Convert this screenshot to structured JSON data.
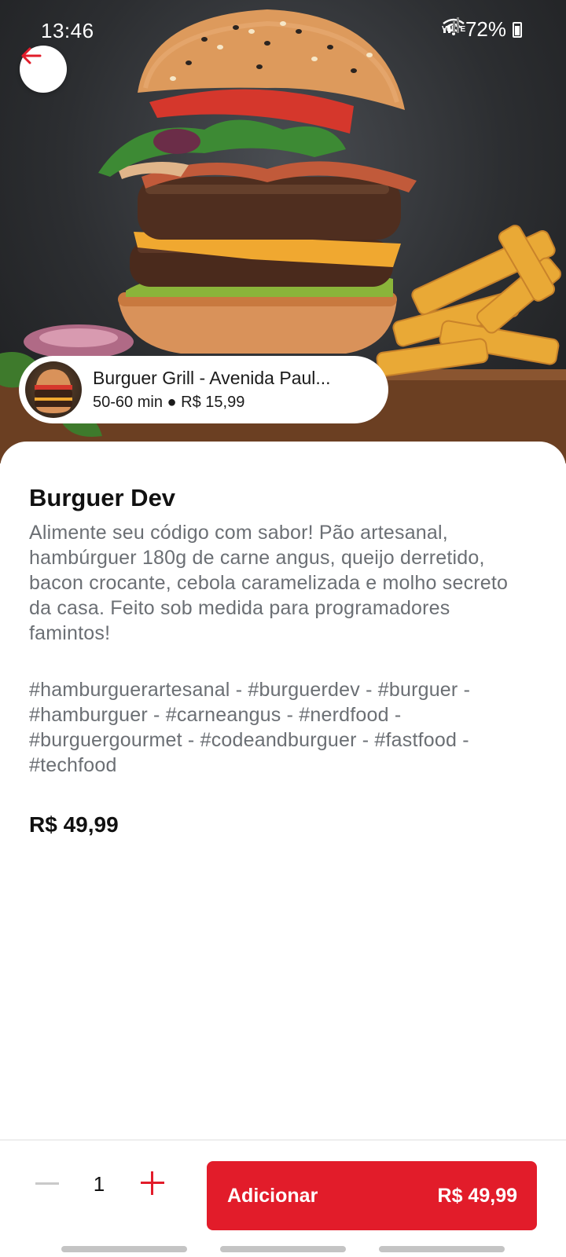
{
  "status_bar": {
    "time": "13:46",
    "network": "VoLTE",
    "battery": "72%"
  },
  "restaurant": {
    "name": "Burguer Grill - Avenida Paul...",
    "delivery_time": "50-60 min",
    "separator": "●",
    "delivery_fee": "R$ 15,99"
  },
  "product": {
    "name": "Burguer Dev",
    "description": "Alimente seu código com sabor! Pão artesanal, hambúrguer 180g de carne angus, queijo derretido, bacon crocante, cebola caramelizada e molho secreto da casa. Feito sob medida para programadores famintos!",
    "hashtags": "#hamburguerartesanal - #burguerdev - #burguer - #hamburguer - #carneangus - #nerdfood - #burguergourmet - #codeandburguer - #fastfood - #techfood",
    "price": "R$ 49,99"
  },
  "cart": {
    "quantity": "1",
    "add_label": "Adicionar",
    "total": "R$ 49,99"
  },
  "icons": {
    "back": "arrow-left-icon",
    "minus": "minus-icon",
    "plus": "plus-icon"
  },
  "colors": {
    "accent": "#e21c2a",
    "text_muted": "#6b6f74"
  }
}
